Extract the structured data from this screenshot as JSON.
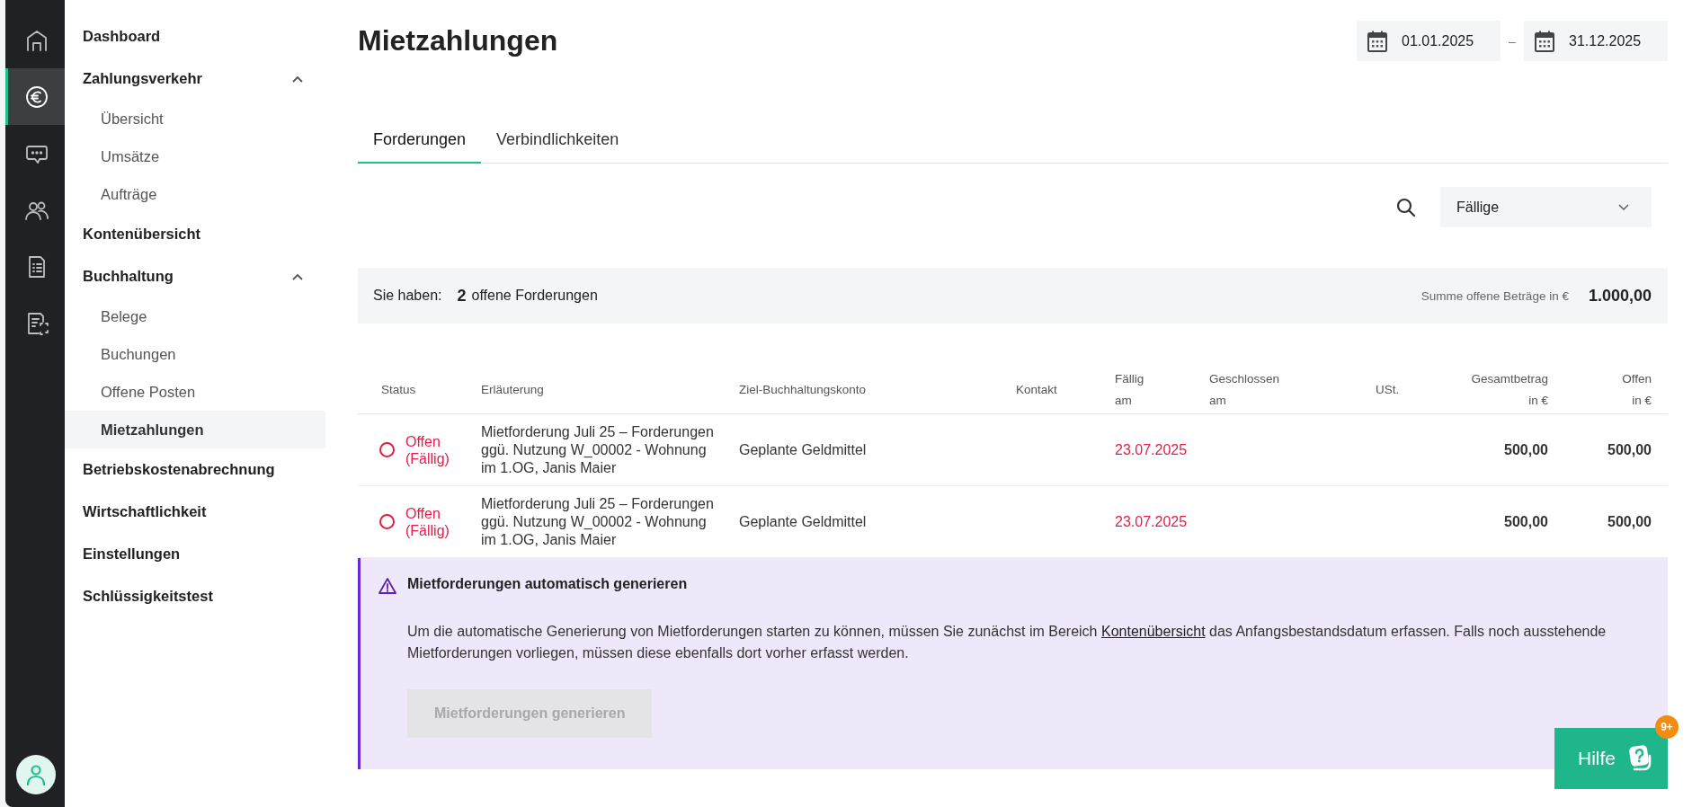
{
  "rail": {
    "items": [
      {
        "selected": false
      },
      {
        "selected": true
      },
      {
        "selected": false
      },
      {
        "selected": false
      },
      {
        "selected": false
      },
      {
        "selected": false
      }
    ]
  },
  "sidebar": {
    "items": [
      {
        "label": "Dashboard",
        "selected": false
      },
      {
        "label": "Zahlungsverkehr",
        "selected": false,
        "expanded": true,
        "children": [
          {
            "label": "Übersicht",
            "selected": false
          },
          {
            "label": "Umsätze",
            "selected": false
          },
          {
            "label": "Aufträge",
            "selected": false
          }
        ]
      },
      {
        "label": "Kontenübersicht",
        "selected": false
      },
      {
        "label": "Buchhaltung",
        "selected": false,
        "expanded": true,
        "children": [
          {
            "label": "Belege",
            "selected": false
          },
          {
            "label": "Buchungen",
            "selected": false
          },
          {
            "label": "Offene Posten",
            "selected": false
          },
          {
            "label": "Mietzahlungen",
            "selected": true
          }
        ]
      },
      {
        "label": "Betriebskostenabrechnung",
        "selected": false
      },
      {
        "label": "Wirtschaftlichkeit",
        "selected": false
      },
      {
        "label": "Einstellungen",
        "selected": false
      },
      {
        "label": "Schlüssigkeitstest",
        "selected": false
      }
    ]
  },
  "page": {
    "title": "Mietzahlungen",
    "date_from": "01.01.2025",
    "date_separator": "–",
    "date_to": "31.12.2025"
  },
  "tabs": [
    {
      "label": "Forderungen",
      "selected": true
    },
    {
      "label": "Verbindlichkeiten",
      "selected": false
    }
  ],
  "filter": {
    "value": "Fällige"
  },
  "summary": {
    "prefix": "Sie haben:",
    "count": "2",
    "count_label": "offene Forderungen",
    "total_label": "Summe offene Beträge in €",
    "total": "1.000,00"
  },
  "table": {
    "columns": [
      {
        "label": "Status"
      },
      {
        "label": "Erläuterung"
      },
      {
        "label": "Ziel-Buchhaltungskonto"
      },
      {
        "label": "Kontakt"
      },
      {
        "label": "Fällig am"
      },
      {
        "label": "Geschlossen am"
      },
      {
        "label": "USt."
      },
      {
        "label": "Gesamtbetrag in €"
      },
      {
        "label": "Offen in €"
      }
    ],
    "rows": [
      {
        "overdue": true,
        "status": "Offen (Fällig)",
        "description": "Mietforderung Juli 25 – Forderungen ggü. Nutzung W_00002 - Wohnung im 1.OG, Janis Maier",
        "account": "Geplante Geldmittel",
        "due": "23.07.2025",
        "total": "500,00",
        "open": "500,00"
      },
      {
        "overdue": true,
        "status": "Offen (Fällig)",
        "description": "Mietforderung Juli 25 – Forderungen ggü. Nutzung W_00002 - Wohnung im 1.OG, Janis Maier",
        "account": "Geplante Geldmittel",
        "due": "23.07.2025",
        "total": "500,00",
        "open": "500,00"
      }
    ]
  },
  "notice": {
    "title": "Mietforderungen automatisch generieren",
    "text_before": "Um die automatische Generierung von Mietforderungen starten zu können, müssen Sie zunächst im Bereich ",
    "link": "Kontenübersicht",
    "text_after": " das Anfangsbestandsdatum erfassen. Falls noch ausstehende Mietforderungen vorliegen, müssen diese ebenfalls dort vorher erfasst werden.",
    "button": {
      "label": "Mietforderungen generieren",
      "disabled": true
    }
  },
  "help": {
    "label": "Hilfe",
    "badge": "9+"
  }
}
